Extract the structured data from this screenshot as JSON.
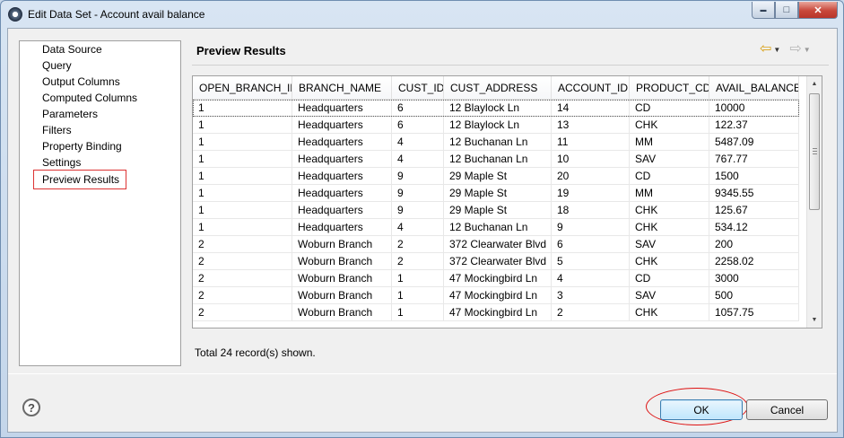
{
  "window": {
    "title": "Edit Data Set - Account avail balance",
    "icon": "eclipse-icon",
    "controls": {
      "minimize": "▬",
      "maximize": "□",
      "close": "✕"
    }
  },
  "nav": {
    "items": [
      {
        "label": "Data Source"
      },
      {
        "label": "Query"
      },
      {
        "label": "Output Columns"
      },
      {
        "label": "Computed Columns"
      },
      {
        "label": "Parameters"
      },
      {
        "label": "Filters"
      },
      {
        "label": "Property Binding"
      },
      {
        "label": "Settings"
      },
      {
        "label": "Preview Results",
        "selected": true
      }
    ]
  },
  "page": {
    "title": "Preview Results",
    "nav_icons": {
      "back": "back-arrow-icon",
      "forward": "forward-arrow-icon"
    }
  },
  "table": {
    "columns": [
      "OPEN_BRANCH_ID",
      "BRANCH_NAME",
      "CUST_ID",
      "CUST_ADDRESS",
      "ACCOUNT_ID",
      "PRODUCT_CD",
      "AVAIL_BALANCE"
    ],
    "rows": [
      [
        "1",
        "Headquarters",
        "6",
        "12 Blaylock Ln",
        "14",
        "CD",
        "10000"
      ],
      [
        "1",
        "Headquarters",
        "6",
        "12 Blaylock Ln",
        "13",
        "CHK",
        "122.37"
      ],
      [
        "1",
        "Headquarters",
        "4",
        "12 Buchanan Ln",
        "11",
        "MM",
        "5487.09"
      ],
      [
        "1",
        "Headquarters",
        "4",
        "12 Buchanan Ln",
        "10",
        "SAV",
        "767.77"
      ],
      [
        "1",
        "Headquarters",
        "9",
        "29 Maple St",
        "20",
        "CD",
        "1500"
      ],
      [
        "1",
        "Headquarters",
        "9",
        "29 Maple St",
        "19",
        "MM",
        "9345.55"
      ],
      [
        "1",
        "Headquarters",
        "9",
        "29 Maple St",
        "18",
        "CHK",
        "125.67"
      ],
      [
        "1",
        "Headquarters",
        "4",
        "12 Buchanan Ln",
        "9",
        "CHK",
        "534.12"
      ],
      [
        "2",
        "Woburn Branch",
        "2",
        "372 Clearwater Blvd",
        "6",
        "SAV",
        "200"
      ],
      [
        "2",
        "Woburn Branch",
        "2",
        "372 Clearwater Blvd",
        "5",
        "CHK",
        "2258.02"
      ],
      [
        "2",
        "Woburn Branch",
        "1",
        "47 Mockingbird Ln",
        "4",
        "CD",
        "3000"
      ],
      [
        "2",
        "Woburn Branch",
        "1",
        "47 Mockingbird Ln",
        "3",
        "SAV",
        "500"
      ],
      [
        "2",
        "Woburn Branch",
        "1",
        "47 Mockingbird Ln",
        "2",
        "CHK",
        "1057.75"
      ]
    ]
  },
  "footer": {
    "record_count": "Total 24 record(s) shown.",
    "ok_label": "OK",
    "cancel_label": "Cancel",
    "help_label": "?"
  }
}
